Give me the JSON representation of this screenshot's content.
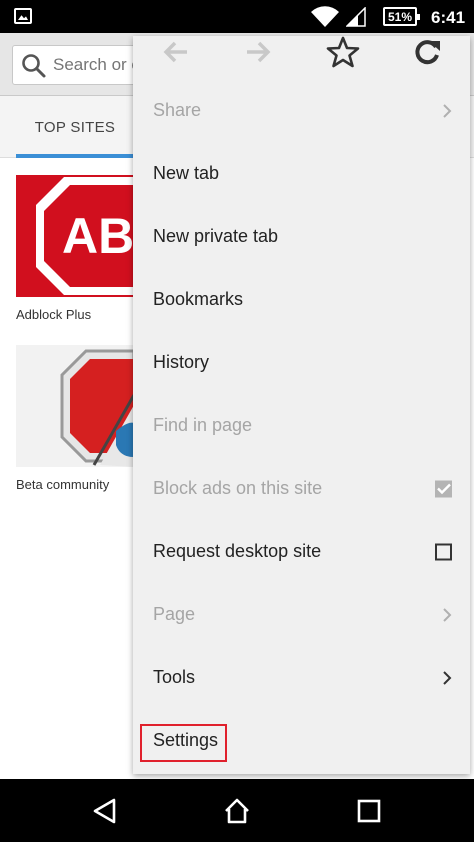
{
  "status_bar": {
    "notification_icon": "image-icon",
    "wifi_icon": "wifi-icon",
    "signal_icon": "signal-icon",
    "battery": "51%",
    "time": "6:41"
  },
  "url_bar": {
    "placeholder": "Search or enter address"
  },
  "tabs": {
    "active": "TOP SITES"
  },
  "top_sites": [
    {
      "label": "Adblock Plus",
      "thumb_text": "AB"
    },
    {
      "label": "Beta community"
    }
  ],
  "menu": {
    "nav_icons": [
      "back-arrow-icon",
      "forward-arrow-icon",
      "star-icon",
      "reload-icon"
    ],
    "items": [
      {
        "label": "Share",
        "enabled": false,
        "trailing": "chevron"
      },
      {
        "label": "New tab",
        "enabled": true
      },
      {
        "label": "New private tab",
        "enabled": true
      },
      {
        "label": "Bookmarks",
        "enabled": true
      },
      {
        "label": "History",
        "enabled": true
      },
      {
        "label": "Find in page",
        "enabled": false
      },
      {
        "label": "Block ads on this site",
        "enabled": false,
        "trailing": "checkbox-checked"
      },
      {
        "label": "Request desktop site",
        "enabled": true,
        "trailing": "checkbox"
      },
      {
        "label": "Page",
        "enabled": false,
        "trailing": "chevron"
      },
      {
        "label": "Tools",
        "enabled": true,
        "trailing": "chevron"
      },
      {
        "label": "Settings",
        "enabled": true,
        "highlighted": true
      }
    ]
  },
  "nav_bar": {
    "icons": [
      "back-triangle-icon",
      "home-icon",
      "recents-square-icon"
    ]
  },
  "colors": {
    "accent": "#3b8fd6",
    "highlight": "#e0202c",
    "adblock_red": "#d10f1e"
  }
}
